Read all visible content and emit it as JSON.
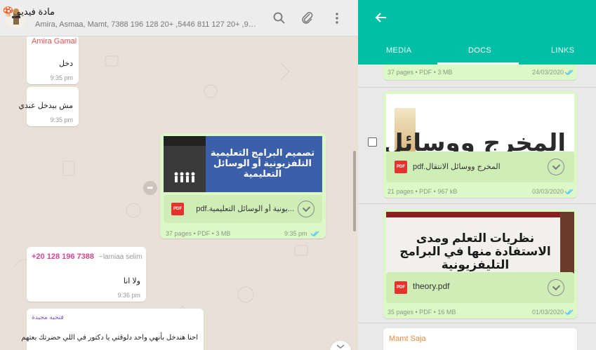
{
  "chat": {
    "title": "مادة فيديو 🍄",
    "members": "Amira, Asmaa, Mamt, 7388 196 128 20+ ,5446 811 127 20+ ,912...",
    "messages": [
      {
        "sender": "Amira Gamal",
        "text": "دخل",
        "time": "9:35 pm"
      },
      {
        "text": "مش بيدخل عندي",
        "time": "9:35 pm"
      }
    ],
    "document": {
      "thumb_title": "تصميم البرامج التعليمية التلفزيونية أو الوسائل التعليمية",
      "filename": "...يونية أو الوسائل التعليمية.pdf",
      "pdf_label": "PDF",
      "meta": "37 pages • PDF • 3 MB",
      "time": "9:35 pm"
    },
    "reply": {
      "phone": "+20 128 196 7388",
      "sender_name": "~lamiaa selim",
      "text": "ولا انا",
      "time": "9:36 pm"
    },
    "last": {
      "sender": "فتحيه مجيدة",
      "text": "احنا هندخل بأنهي واحد دلوقتي يا دكتور في اللي حضرتك بعتهم"
    }
  },
  "media": {
    "tabs": [
      "MEDIA",
      "DOCS",
      "LINKS"
    ],
    "active_tab": "DOCS",
    "top_meta": "37 pages • PDF • 3 MB",
    "top_date": "24/03/2020",
    "cards": [
      {
        "thumb_text": "المخرج ووسائل",
        "filename": "المخرج ووسائل الانتقال.pdf",
        "pdf_label": "PDF",
        "meta": "21 pages • PDF • 967 kB",
        "date": "03/03/2020"
      },
      {
        "thumb_text": "نظريات التعلم ومدى الاستفادة منها في البرامج التليفزيونية",
        "filename": "theory.pdf",
        "pdf_label": "PDF",
        "meta": "35 pages • PDF • 16 MB",
        "date": "01/03/2020"
      }
    ],
    "bottom_sender": "Mamt Saja"
  },
  "colors": {
    "accent": "#00bfa5",
    "outgoing": "#dcf8c6",
    "sender_red": "#e2504c",
    "sender_pink": "#d6458e",
    "pdf_red": "#e5322d"
  },
  "icons": [
    "back-arrow-icon",
    "search-icon",
    "attach-icon",
    "menu-icon",
    "forward-icon",
    "download-icon",
    "pdf-icon",
    "check-icon"
  ]
}
